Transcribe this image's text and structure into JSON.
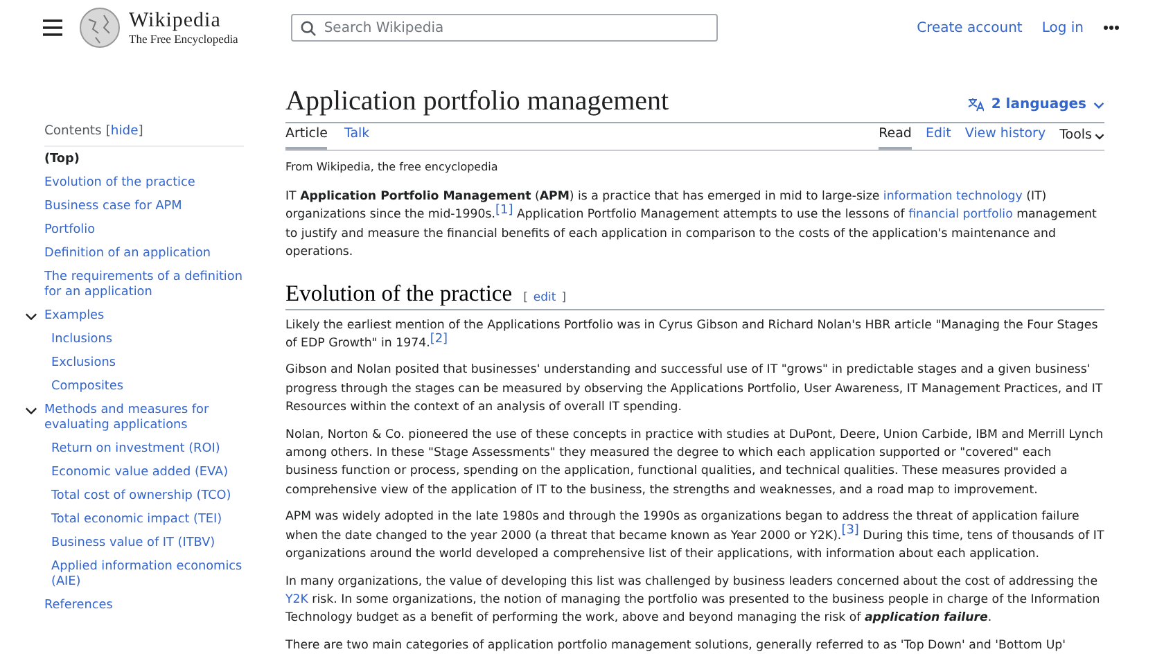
{
  "header": {
    "logo_title": "Wikipedia",
    "logo_subtitle": "The Free Encyclopedia",
    "search": {
      "placeholder": "Search Wikipedia"
    },
    "links": [
      "Create account",
      "Log in"
    ]
  },
  "toc": {
    "title": "Contents",
    "toggle": {
      "open": "[",
      "label": "hide",
      "close": "]"
    },
    "items": [
      {
        "label": "(Top)",
        "selected": true
      },
      {
        "label": "Evolution of the practice",
        "selected": false
      },
      {
        "label": "Business case for APM",
        "selected": false
      },
      {
        "label": "Portfolio",
        "selected": false
      },
      {
        "label": "Definition of an application",
        "selected": false
      },
      {
        "label": "The requirements of a definition for an application",
        "selected": false
      },
      {
        "label": "Examples",
        "selected": false,
        "expanded": true,
        "children": [
          {
            "label": "Inclusions",
            "selected": false
          },
          {
            "label": "Exclusions",
            "selected": false
          },
          {
            "label": "Composites",
            "selected": false
          }
        ]
      },
      {
        "label": "Methods and measures for evaluating applications",
        "selected": false,
        "expanded": true,
        "children": [
          {
            "label": "Return on investment (ROI)",
            "selected": false
          },
          {
            "label": "Economic value added (EVA)",
            "selected": false
          },
          {
            "label": "Total cost of ownership (TCO)",
            "selected": false
          },
          {
            "label": "Total economic impact (TEI)",
            "selected": false
          },
          {
            "label": "Business value of IT (ITBV)",
            "selected": false
          },
          {
            "label": "Applied information economics (AIE)",
            "selected": false
          }
        ]
      },
      {
        "label": "References",
        "selected": false
      }
    ]
  },
  "article": {
    "title": "Application portfolio management",
    "languages": "2 languages",
    "tabs_left": [
      {
        "label": "Article",
        "selected": true
      },
      {
        "label": "Talk",
        "selected": false
      }
    ],
    "tabs_right": [
      {
        "label": "Read",
        "selected": true
      },
      {
        "label": "Edit",
        "selected": false
      },
      {
        "label": "View history",
        "selected": false
      }
    ],
    "tools": "Tools",
    "tagline": "From Wikipedia, the free encyclopedia",
    "blocks": [
      {
        "kind": "paragraph",
        "segments": [
          {
            "kind": "text",
            "text": "IT **Application Portfolio Management** (**APM**) is a practice that has emerged in mid to large-size "
          },
          {
            "kind": "link",
            "text": "information technology"
          },
          {
            "kind": "text",
            "text": " (IT) organizations since the mid-1990s."
          },
          {
            "kind": "ref",
            "text": "[1]"
          },
          {
            "kind": "text",
            "text": " Application Portfolio Management attempts to use the lessons of "
          },
          {
            "kind": "link",
            "text": "financial portfolio"
          },
          {
            "kind": "text",
            "text": " management to justify and measure the financial benefits of each application in comparison to the costs of the application's maintenance and operations."
          }
        ]
      },
      {
        "kind": "heading",
        "text": "Evolution of the practice",
        "edit": {
          "open": "[",
          "label": "edit",
          "close": "]"
        }
      },
      {
        "kind": "paragraph",
        "segments": [
          {
            "kind": "text",
            "text": "Likely the earliest mention of the Applications Portfolio was in Cyrus Gibson and Richard Nolan's HBR article \"Managing the Four Stages of EDP Growth\" in 1974."
          },
          {
            "kind": "ref",
            "text": "[2]"
          }
        ]
      },
      {
        "kind": "paragraph",
        "segments": [
          {
            "kind": "text",
            "text": "Gibson and Nolan posited that businesses' understanding and successful use of IT \"grows\" in predictable stages and a given business' progress through the stages can be measured by observing the Applications Portfolio, User Awareness, IT Management Practices, and IT Resources within the context of an analysis of overall IT spending."
          }
        ]
      },
      {
        "kind": "paragraph",
        "segments": [
          {
            "kind": "text",
            "text": "Nolan, Norton & Co. pioneered the use of these concepts in practice with studies at DuPont, Deere, Union Carbide, IBM and Merrill Lynch among others. In these \"Stage Assessments\" they measured the degree to which each application supported or \"covered\" each business function or process, spending on the application, functional qualities, and technical qualities. These measures provided a comprehensive view of the application of IT to the business, the strengths and weaknesses, and a road map to improvement."
          }
        ]
      },
      {
        "kind": "paragraph",
        "segments": [
          {
            "kind": "text",
            "text": "APM was widely adopted in the late 1980s and through the 1990s as organizations began to address the threat of application failure when the date changed to the year 2000 (a threat that became known as Year 2000 or Y2K)."
          },
          {
            "kind": "ref",
            "text": "[3]"
          },
          {
            "kind": "text",
            "text": " During this time, tens of thousands of IT organizations around the world developed a comprehensive list of their applications, with information about each application."
          }
        ]
      },
      {
        "kind": "paragraph",
        "segments": [
          {
            "kind": "text",
            "text": "In many organizations, the value of developing this list was challenged by business leaders concerned about the cost of addressing the "
          },
          {
            "kind": "link",
            "text": "Y2K"
          },
          {
            "kind": "text",
            "text": " risk. In some organizations, the notion of managing the portfolio was presented to the business people in charge of the Information Technology budget as a benefit of performing the work, above and beyond managing the risk of "
          },
          {
            "kind": "emphasis",
            "text": "application failure"
          },
          {
            "kind": "text",
            "text": "."
          }
        ]
      },
      {
        "kind": "paragraph",
        "segments": [
          {
            "kind": "text",
            "text": "There are two main categories of application portfolio management solutions, generally referred to as 'Top Down' and 'Bottom Up'"
          }
        ]
      }
    ]
  }
}
